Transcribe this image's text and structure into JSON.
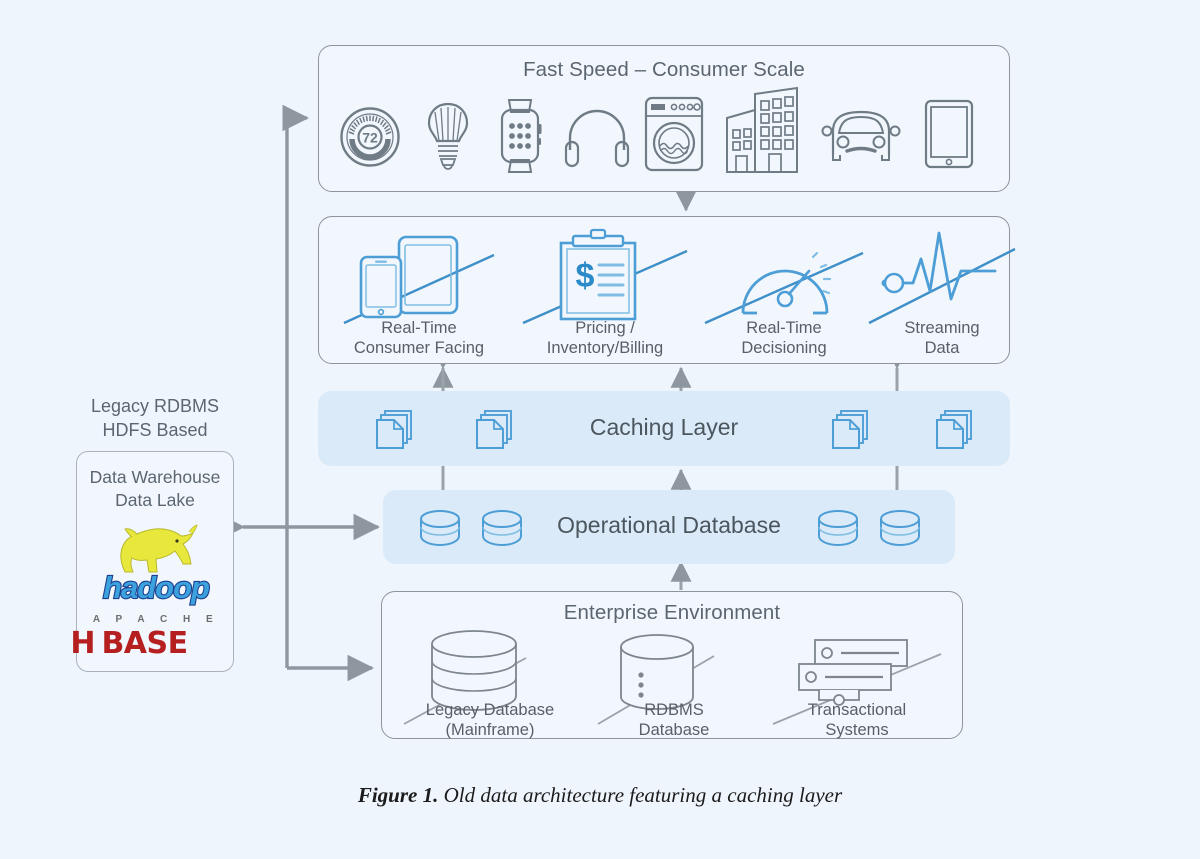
{
  "figure": {
    "number": "Figure 1.",
    "caption": "Old data architecture featuring a caching layer"
  },
  "colors": {
    "page_background": "#eff5fd",
    "panel_fill": "#f2f7fd",
    "panel_border": "#8d949c",
    "band_fill": "#daeaf8",
    "accent_blue": "#56a2d6",
    "text_gray": "#5b6670",
    "arrow_gray": "#8e979f",
    "hadoop_blue": "#3ba2dd",
    "hbase_red": "#b51f1f"
  },
  "consumer_panel": {
    "title": "Fast  Speed – Consumer Scale",
    "icons": [
      {
        "name": "thermostat-icon",
        "label": "72"
      },
      {
        "name": "lightbulb-icon",
        "label": ""
      },
      {
        "name": "smartwatch-icon",
        "label": ""
      },
      {
        "name": "headphones-icon",
        "label": ""
      },
      {
        "name": "washing-machine-icon",
        "label": ""
      },
      {
        "name": "buildings-icon",
        "label": ""
      },
      {
        "name": "car-icon",
        "label": ""
      },
      {
        "name": "tablet-icon",
        "label": ""
      }
    ]
  },
  "workloads_panel": {
    "items": [
      {
        "icon": "devices-icon",
        "line1": "Real-Time",
        "line2": "Consumer Facing"
      },
      {
        "icon": "clipboard-dollar-icon",
        "line1": "Pricing /",
        "line2": "Inventory/Billing"
      },
      {
        "icon": "gauge-icon",
        "line1": "Real-Time",
        "line2": "Decisioning"
      },
      {
        "icon": "pulse-icon",
        "line1": "Streaming",
        "line2": "Data"
      }
    ]
  },
  "caching_layer": {
    "title": "Caching Layer",
    "icon_name": "documents-stack-icon",
    "icon_count": 4
  },
  "operational_database": {
    "title": "Operational Database",
    "icon_name": "database-cylinder-icon",
    "icon_count": 4
  },
  "enterprise_panel": {
    "title": "Enterprise Environment",
    "items": [
      {
        "icon": "stacked-disks-icon",
        "line1": "Legacy Database",
        "line2": "(Mainframe)"
      },
      {
        "icon": "database-cylinder-icon",
        "line1": "RDBMS",
        "line2": "Database"
      },
      {
        "icon": "server-rack-icon",
        "line1": "Transactional",
        "line2": "Systems"
      }
    ]
  },
  "sidebar": {
    "heading_line1": "Legacy RDBMS",
    "heading_line2": "HDFS Based",
    "box_title_line1": "Data Warehouse",
    "box_title_line2": "Data Lake",
    "logos": [
      {
        "name": "hadoop-logo",
        "text": "hadoop"
      },
      {
        "name": "hbase-logo",
        "top_text": "A P A C H E",
        "main_text_h": "H",
        "main_text_rest": "BASE"
      }
    ]
  }
}
